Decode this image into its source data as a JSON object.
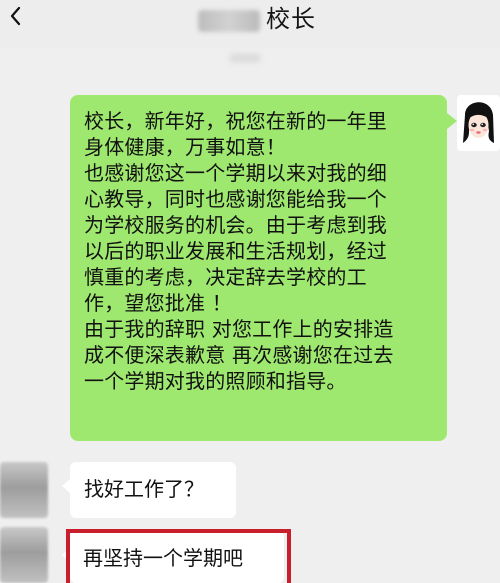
{
  "header": {
    "title": "校长"
  },
  "messages": [
    {
      "side": "right",
      "lines": [
        "校长，新年好，祝您在新的一年里",
        "身体健康，万事如意！",
        "也感谢您这一个学期以来对我的细",
        "心教导，同时也感谢您能给我一个",
        "为学校服务的机会。由于考虑到我",
        "以后的职业发展和生活规划，经过",
        "慎重的考虑，决定辞去学校的工",
        "作，望您批准 ！",
        "由于我的辞职 对您工作上的安排造",
        "成不便深表歉意 再次感谢您在过去",
        "一个学期对我的照顾和指导。"
      ]
    },
    {
      "side": "left",
      "text": "找好工作了？"
    },
    {
      "side": "left",
      "text": "再坚持一个学期吧"
    }
  ]
}
